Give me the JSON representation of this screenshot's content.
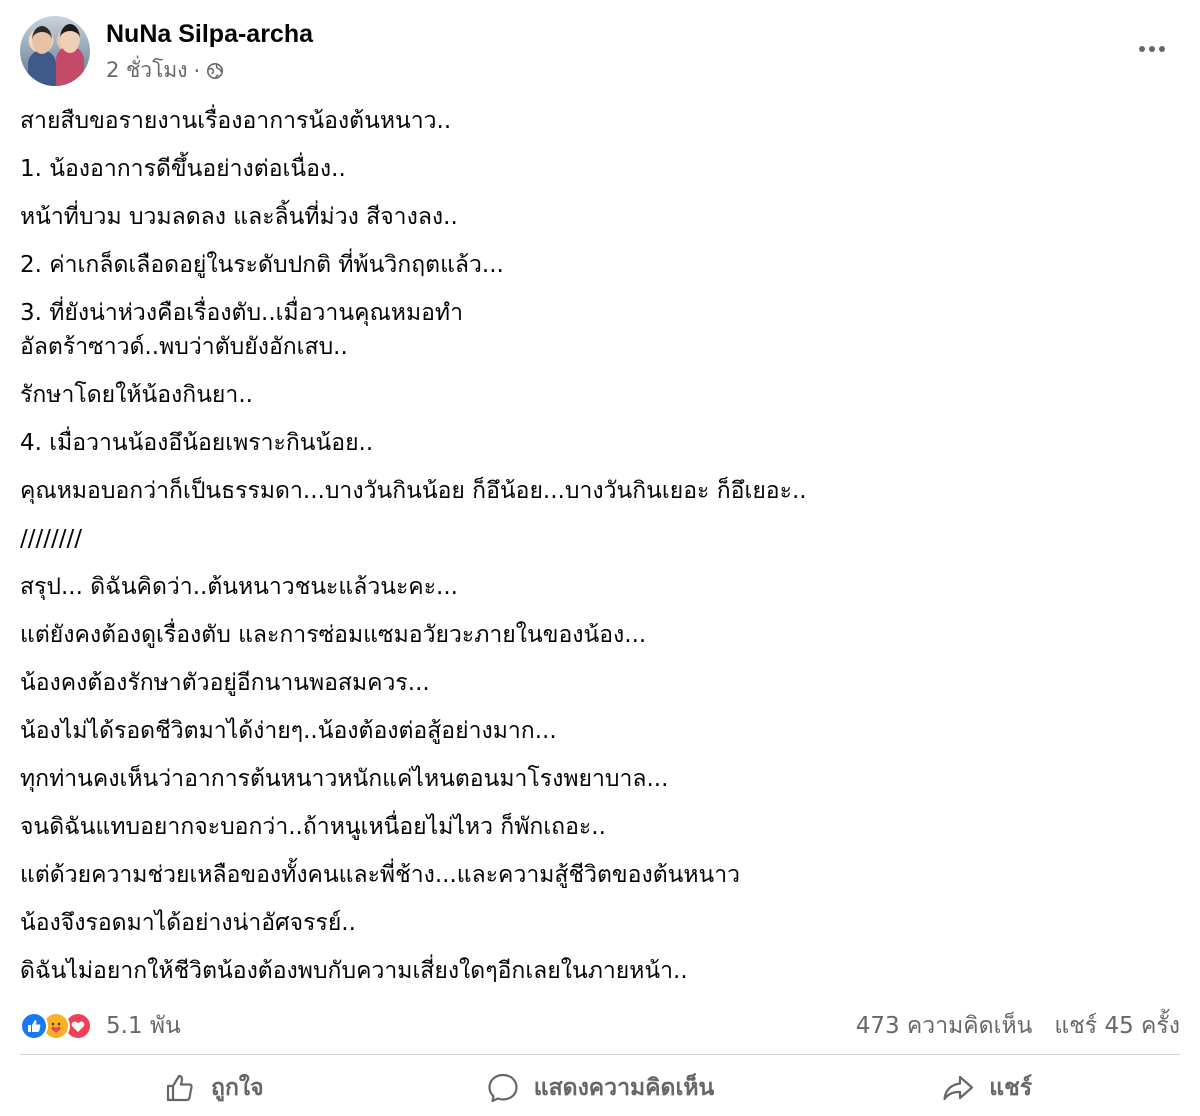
{
  "post": {
    "author": "NuNa Silpa-archa",
    "time": "2 ชั่วโมง",
    "separator": "·",
    "privacy_icon": "globe-icon",
    "more_icon": "more-horizontal-icon",
    "paragraphs": [
      "สายสืบขอรายงานเรื่องอาการน้องต้นหนาว..",
      "1. น้องอาการดีขึ้นอย่างต่อเนื่อง..",
      "หน้าที่บวม บวมลดลง และลิ้นที่ม่วง สีจางลง..",
      "2. ค่าเกล็ดเลือดอยู่ในระดับปกติ ที่พ้นวิกฤตแล้ว...",
      "3. ที่ยังน่าห่วงคือเรื่องตับ..เมื่อวานคุณหมอทำ",
      "อัลตร้าซาวด์..พบว่าตับยังอักเสบ..",
      "รักษาโดยให้น้องกินยา..",
      "4. เมื่อวานน้องอึน้อยเพราะกินน้อย..",
      "คุณหมอบอกว่าก็เป็นธรรมดา...บางวันกินน้อย ก็อึน้อย...บางวันกินเยอะ ก็อึเยอะ..",
      "////////",
      "สรุป... ดิฉันคิดว่า..ต้นหนาวชนะแล้วนะคะ...",
      "แต่ยังคงต้องดูเรื่องตับ และการซ่อมแซมอวัยวะภายในของน้อง...",
      "น้องคงต้องรักษาตัวอยู่อีกนานพอสมควร...",
      "น้องไม่ได้รอดชีวิตมาได้ง่ายๆ..น้องต้องต่อสู้อย่างมาก...",
      "ทุกท่านคงเห็นว่าอาการต้นหนาวหนักแค่ไหนตอนมาโรงพยาบาล...",
      "จนดิฉันแทบอยากจะบอกว่า..ถ้าหนูเหนื่อยไม่ไหว ก็พักเถอะ..",
      "แต่ด้วยความช่วยเหลือของทั้งคนและพี่ช้าง...และความสู้ชีวิตของต้นหนาว",
      "น้องจึงรอดมาได้อย่างน่าอัศจรรย์..",
      "ดิฉันไม่อยากให้ชีวิตน้องต้องพบกับความเสี่ยงใดๆอีกเลยในภายหน้า.."
    ]
  },
  "stats": {
    "reaction_icons": [
      "like-icon",
      "care-icon",
      "love-icon"
    ],
    "reactions_count": "5.1 พัน",
    "comments": "473 ความคิดเห็น",
    "shares": "แชร์ 45 ครั้ง"
  },
  "actions": {
    "like_label": "ถูกใจ",
    "comment_label": "แสดงความคิดเห็น",
    "share_label": "แชร์"
  },
  "colors": {
    "text": "#050505",
    "secondary": "#65676b",
    "like_blue": "#1877f2",
    "love_red": "#f33e58",
    "care_yellow": "#f7b125",
    "divider": "#ced0d4"
  }
}
